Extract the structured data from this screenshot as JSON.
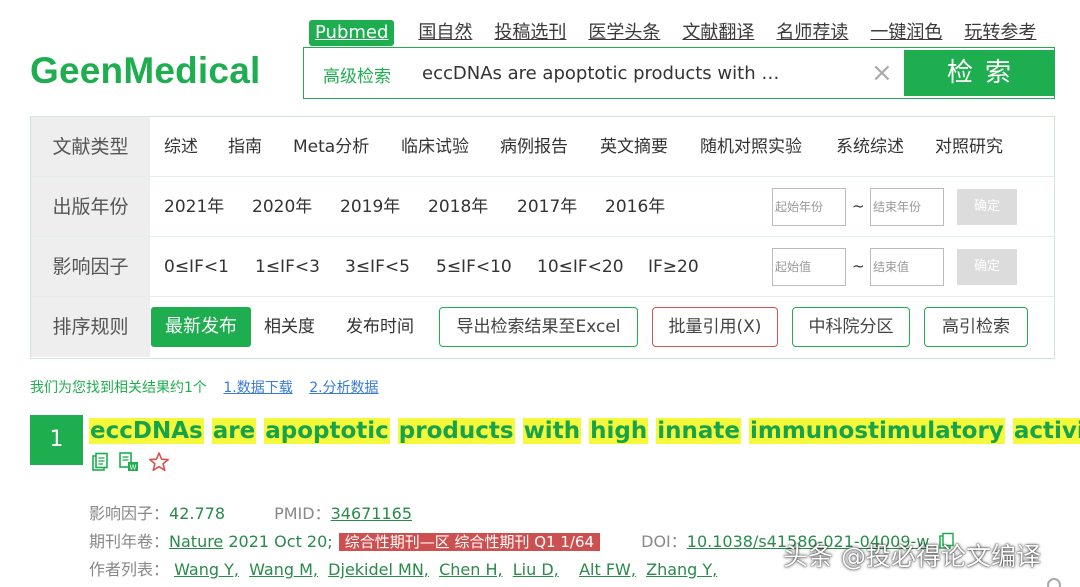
{
  "logo": "GeenMedical",
  "topnav": [
    "Pubmed",
    "国自然",
    "投稿选刊",
    "医学头条",
    "文献翻译",
    "名师荐读",
    "一键润色",
    "玩转参考"
  ],
  "search": {
    "advanced_label": "高级检索",
    "query": "eccDNAs are apoptotic products with …",
    "clear_icon": "×",
    "button_label": "检索"
  },
  "filters": {
    "doc_type": {
      "label": "文献类型",
      "options": [
        "综述",
        "指南",
        "Meta分析",
        "临床试验",
        "病例报告",
        "英文摘要",
        "随机对照实验",
        "系统综述",
        "对照研究"
      ]
    },
    "year": {
      "label": "出版年份",
      "options": [
        "2021年",
        "2020年",
        "2019年",
        "2018年",
        "2017年",
        "2016年"
      ],
      "start_placeholder": "起始年份",
      "end_placeholder": "结束年份",
      "tilde": "~",
      "confirm": "确定"
    },
    "impact": {
      "label": "影响因子",
      "options": [
        "0≤IF<1",
        "1≤IF<3",
        "3≤IF<5",
        "5≤IF<10",
        "10≤IF<20",
        "IF≥20"
      ],
      "start_placeholder": "起始值",
      "end_placeholder": "结束值",
      "tilde": "~",
      "confirm": "确定"
    },
    "sort": {
      "label": "排序规则",
      "active": "最新发布",
      "options": [
        "相关度",
        "发布时间"
      ],
      "buttons": [
        "导出检索结果至Excel",
        "批量引用(X)",
        "中科院分区",
        "高引检索"
      ]
    }
  },
  "result_info": {
    "text": "我们为您找到相关结果约1个",
    "link1": "1.数据下载",
    "link2": "2.分析数据"
  },
  "result": {
    "number": "1",
    "title_words": [
      "eccDNAs",
      "are",
      "apoptotic",
      "products",
      "with",
      "high",
      "innate",
      "immunostimulatory",
      "activity"
    ],
    "title_end": ".",
    "if_label": "影响因子：",
    "if_value": "42.778",
    "pmid_label": "PMID：",
    "pmid": "34671165",
    "journal_label": "期刊年卷：",
    "journal": "Nature",
    "date": "2021 Oct 20;",
    "category_badge": "综合性期刊—区 综合性期刊 Q1 1/64",
    "doi_label": "DOI：",
    "doi": "10.1038/s41586-021-04009-w",
    "authors_label": "作者列表：",
    "authors": [
      "Wang Y,",
      "Wang M,",
      "Djekidel MN,",
      "Chen H,",
      "Liu D,",
      "Alt FW,",
      "Zhang Y,"
    ]
  },
  "watermark": "头条 @投必得论文编译",
  "colors": {
    "brand_green": "#1fae4f",
    "highlight_yellow": "#f4f93c",
    "badge_red": "#cc5050",
    "link_blue": "#3a7bd5"
  }
}
